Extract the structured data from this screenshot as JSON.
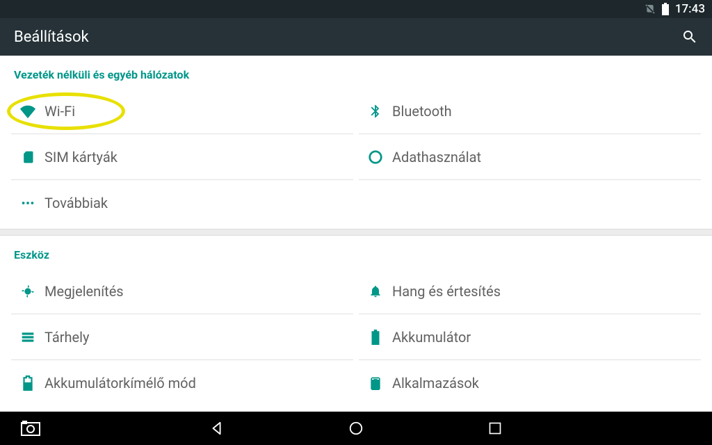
{
  "status": {
    "time": "17:43"
  },
  "appbar": {
    "title": "Beállítások"
  },
  "sections": {
    "wireless": {
      "header": "Vezeték nélküli és egyéb hálózatok"
    },
    "device": {
      "header": "Eszköz"
    }
  },
  "items": {
    "wifi": {
      "label": "Wi-Fi"
    },
    "bluetooth": {
      "label": "Bluetooth"
    },
    "sim": {
      "label": "SIM kártyák"
    },
    "data": {
      "label": "Adathasználat"
    },
    "more": {
      "label": "Továbbiak"
    },
    "display": {
      "label": "Megjelenítés"
    },
    "sound": {
      "label": "Hang és értesítés"
    },
    "storage": {
      "label": "Tárhely"
    },
    "battery": {
      "label": "Akkumulátor"
    },
    "saver": {
      "label": "Akkumulátorkímélő mód"
    },
    "apps": {
      "label": "Alkalmazások"
    }
  },
  "colors": {
    "accent": "#009688"
  }
}
